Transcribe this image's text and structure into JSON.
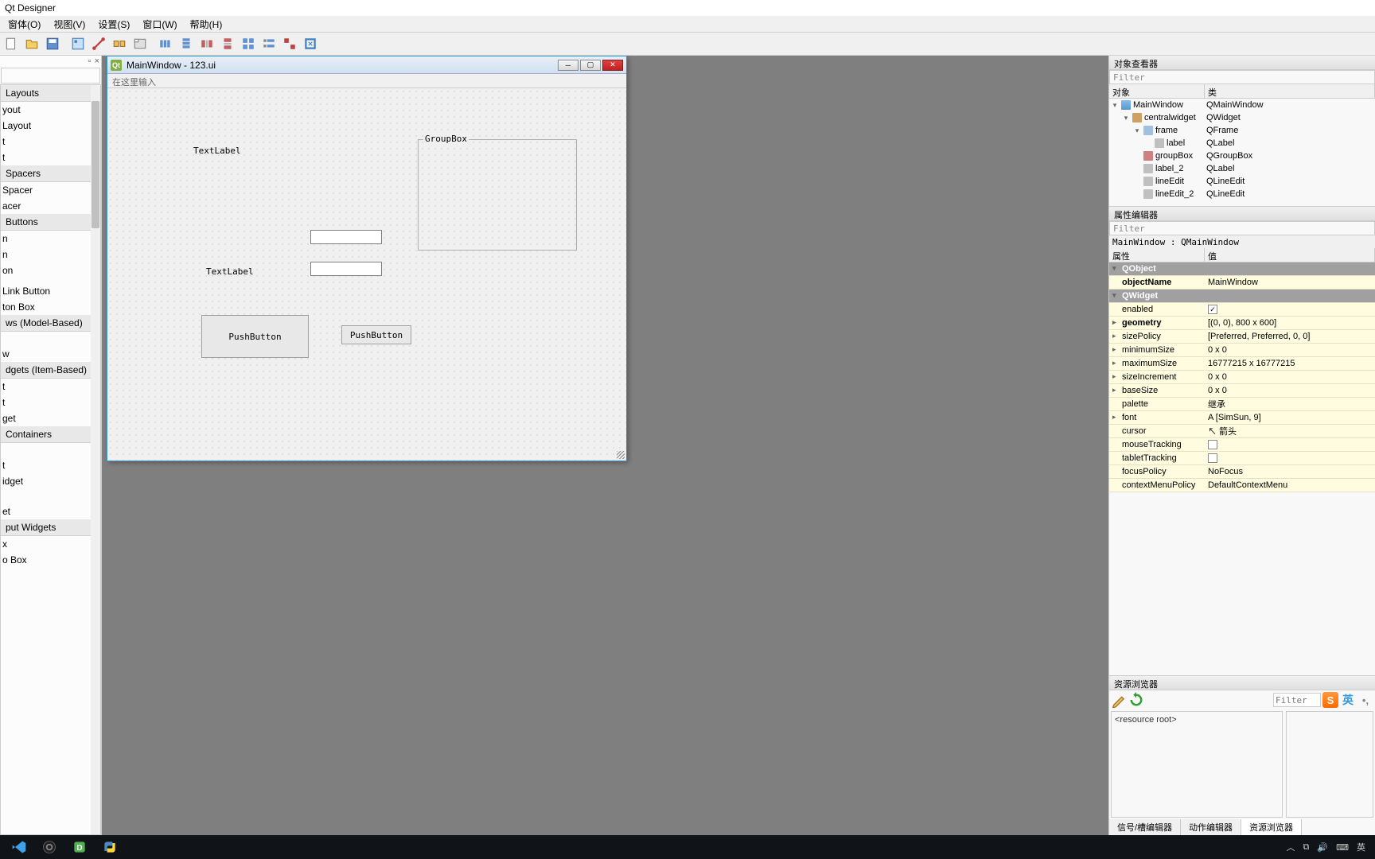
{
  "app_title": "Qt Designer",
  "menus": {
    "form": "窗体(O)",
    "view": "视图(V)",
    "settings": "设置(S)",
    "window": "窗口(W)",
    "help": "帮助(H)"
  },
  "widget_box": {
    "categories": {
      "layouts": "Layouts",
      "spacers": "Spacers",
      "buttons": "Buttons",
      "item_views": "ws (Model-Based)",
      "item_widgets": "dgets (Item-Based)",
      "containers": "Containers",
      "input_widgets": "put Widgets"
    },
    "items": {
      "layout1": "yout",
      "layout2": "Layout",
      "layout3": "t",
      "layout4": "t",
      "spacer1": "Spacer",
      "spacer2": "acer",
      "btn1": "n",
      "btn2": "n",
      "btn3": "on",
      "btn4": "",
      "btn5": " Link Button",
      "btn6": "ton Box",
      "iv1": "",
      "iv2": "",
      "iv3": "",
      "iv4": "w",
      "iw1": "t",
      "iw2": "t",
      "iw3": "get",
      "c1": "",
      "c2": "",
      "c3": "",
      "c4": "t",
      "c5": "idget",
      "c6": "",
      "c7": "",
      "c8": "",
      "c9": "et",
      "in1": "x",
      "in2": "o Box"
    }
  },
  "design_window": {
    "title": "MainWindow - 123.ui",
    "menu_placeholder": "在这里输入",
    "labels": {
      "label1": "TextLabel",
      "label2": "TextLabel"
    },
    "groupbox_title": "GroupBox",
    "buttons": {
      "push1": "PushButton",
      "push2": "PushButton"
    }
  },
  "object_inspector": {
    "title": "对象查看器",
    "filter_placeholder": "Filter",
    "headers": {
      "object": "对象",
      "class": "类"
    },
    "tree": [
      {
        "name": "MainWindow",
        "class": "QMainWindow",
        "indent": 0,
        "icon": "win",
        "exp": "▾"
      },
      {
        "name": "centralwidget",
        "class": "QWidget",
        "indent": 1,
        "icon": "widget",
        "exp": "▾"
      },
      {
        "name": "frame",
        "class": "QFrame",
        "indent": 2,
        "icon": "frame",
        "exp": "▾"
      },
      {
        "name": "label",
        "class": "QLabel",
        "indent": 3,
        "icon": "label",
        "exp": ""
      },
      {
        "name": "groupBox",
        "class": "QGroupBox",
        "indent": 2,
        "icon": "group",
        "exp": ""
      },
      {
        "name": "label_2",
        "class": "QLabel",
        "indent": 2,
        "icon": "label",
        "exp": ""
      },
      {
        "name": "lineEdit",
        "class": "QLineEdit",
        "indent": 2,
        "icon": "label",
        "exp": ""
      },
      {
        "name": "lineEdit_2",
        "class": "QLineEdit",
        "indent": 2,
        "icon": "label",
        "exp": ""
      }
    ]
  },
  "property_editor": {
    "title": "属性编辑器",
    "filter_placeholder": "Filter",
    "class_line": "MainWindow : QMainWindow",
    "headers": {
      "prop": "属性",
      "value": "值"
    },
    "rows": [
      {
        "type": "cat",
        "name": "QObject"
      },
      {
        "type": "prop",
        "name": "objectName",
        "value": "MainWindow",
        "bold": true
      },
      {
        "type": "cat",
        "name": "QWidget"
      },
      {
        "type": "prop",
        "name": "enabled",
        "value": "",
        "check": true,
        "checked": true
      },
      {
        "type": "prop",
        "name": "geometry",
        "value": "[(0, 0), 800 x 600]",
        "exp": "▸",
        "bold": true
      },
      {
        "type": "prop",
        "name": "sizePolicy",
        "value": "[Preferred, Preferred, 0, 0]",
        "exp": "▸"
      },
      {
        "type": "prop",
        "name": "minimumSize",
        "value": "0 x 0",
        "exp": "▸"
      },
      {
        "type": "prop",
        "name": "maximumSize",
        "value": "16777215 x 16777215",
        "exp": "▸"
      },
      {
        "type": "prop",
        "name": "sizeIncrement",
        "value": "0 x 0",
        "exp": "▸"
      },
      {
        "type": "prop",
        "name": "baseSize",
        "value": "0 x 0",
        "exp": "▸"
      },
      {
        "type": "prop",
        "name": "palette",
        "value": "继承"
      },
      {
        "type": "prop",
        "name": "font",
        "value": "A   [SimSun, 9]",
        "exp": "▸"
      },
      {
        "type": "prop",
        "name": "cursor",
        "value": "↖  箭头"
      },
      {
        "type": "prop",
        "name": "mouseTracking",
        "value": "",
        "check": true,
        "checked": false
      },
      {
        "type": "prop",
        "name": "tabletTracking",
        "value": "",
        "check": true,
        "checked": false
      },
      {
        "type": "prop",
        "name": "focusPolicy",
        "value": "NoFocus"
      },
      {
        "type": "prop",
        "name": "contextMenuPolicy",
        "value": "DefaultContextMenu"
      }
    ]
  },
  "resource_browser": {
    "title": "资源浏览器",
    "filter_placeholder": "Filter",
    "root": "<resource root>",
    "tabs": {
      "signal": "信号/槽编辑器",
      "action": "动作编辑器",
      "resource": "资源浏览器"
    }
  },
  "tray": {
    "ime": "英"
  }
}
